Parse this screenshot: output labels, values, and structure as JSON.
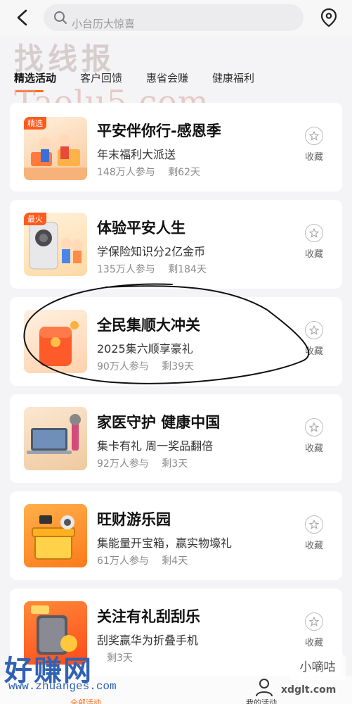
{
  "search": {
    "placeholder": "小台历大惊喜"
  },
  "watermarks": {
    "top": "找线报",
    "site": "Taolu5.com",
    "bottom": "好赚网",
    "bottom_url": "www.zhuanges.com",
    "corner": "小嘀咕",
    "corner_url": "xdglt.com"
  },
  "tabs": [
    {
      "label": "精选活动",
      "active": true
    },
    {
      "label": "客户回馈",
      "active": false
    },
    {
      "label": "惠省会赚",
      "active": false
    },
    {
      "label": "健康福利",
      "active": false
    }
  ],
  "activities": [
    {
      "badge": "精选",
      "title": "平安伴你行-感恩季",
      "subtitle": "年末福利大派送",
      "participants": "148万人参与",
      "remaining": "剩62天",
      "fav_label": "收藏",
      "thumb_color": "#fde3c6"
    },
    {
      "badge": "最火",
      "title": "体验平安人生",
      "subtitle": "学保险知识分2亿金币",
      "participants": "135万人参与",
      "remaining": "剩184天",
      "fav_label": "收藏",
      "thumb_color": "#ffe6c2"
    },
    {
      "badge": "",
      "title": "全民集顺大冲关",
      "subtitle": "2025集六顺享豪礼",
      "participants": "90万人参与",
      "remaining": "剩39天",
      "fav_label": "收藏",
      "thumb_color": "#ffe2c8"
    },
    {
      "badge": "",
      "title": "家医守护 健康中国",
      "subtitle": "集卡有礼 周一奖品翻倍",
      "participants": "92万人参与",
      "remaining": "剩3天",
      "fav_label": "收藏",
      "thumb_color": "#f6d9b6"
    },
    {
      "badge": "",
      "title": "旺财游乐园",
      "subtitle": "集能量开宝箱，赢实物壕礼",
      "participants": "61万人参与",
      "remaining": "剩4天",
      "fav_label": "收藏",
      "thumb_color": "#ff9a2e"
    },
    {
      "badge": "",
      "title": "关注有礼刮刮乐",
      "subtitle": "刮奖赢华为折叠手机",
      "participants": "",
      "remaining": "剩3天",
      "fav_label": "收藏",
      "thumb_color": "#ff6a2a"
    }
  ],
  "bottom_nav": {
    "left_label": "全部活动",
    "right_label": "我的活动"
  },
  "colors": {
    "accent": "#ff6a1a",
    "background": "#f4f4f6"
  }
}
